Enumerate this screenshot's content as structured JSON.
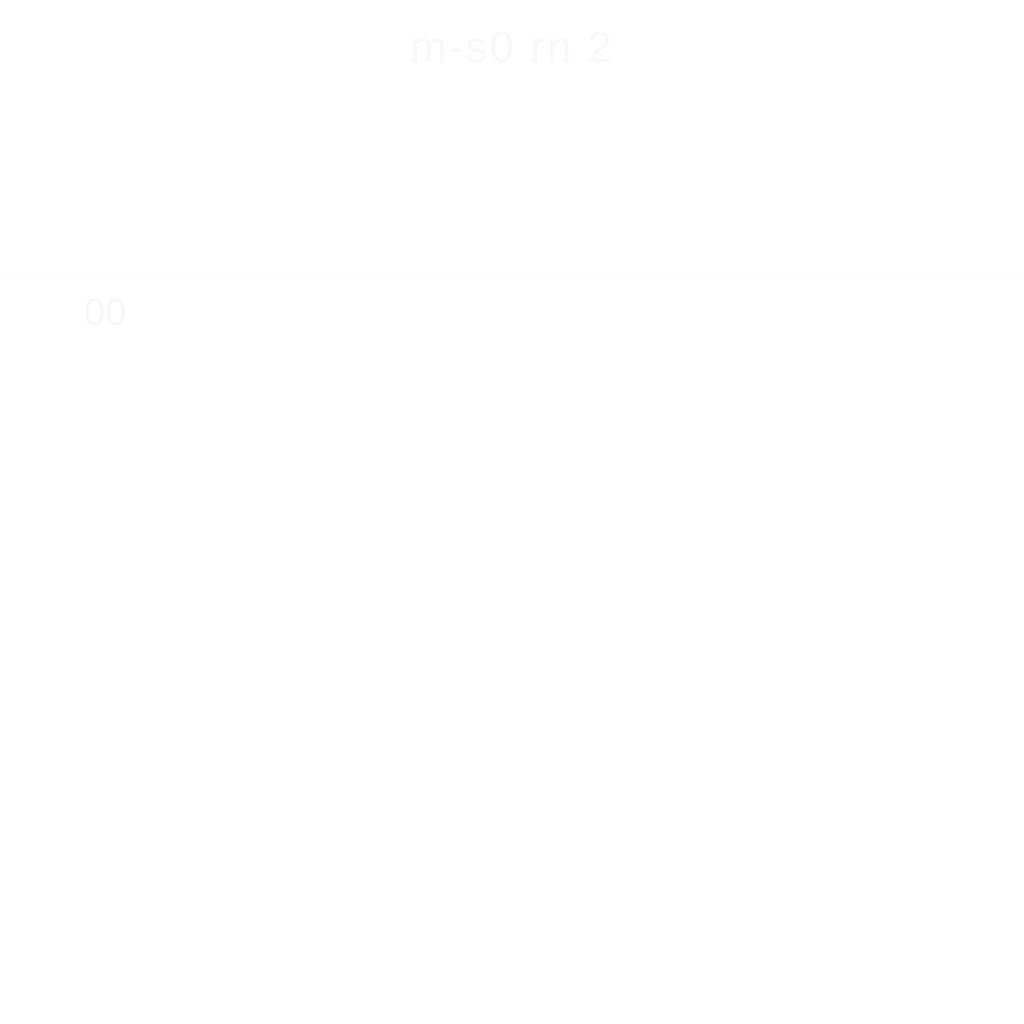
{
  "theme": {
    "background": "#ffffff",
    "header_text_color": "#f9f9f9",
    "row_text_color": "#f7f7f7",
    "separator_color": "#fcfcfc"
  },
  "header": {
    "title": "m-s0 rn 2"
  },
  "list": {
    "items": [
      {
        "label": "00"
      }
    ]
  }
}
